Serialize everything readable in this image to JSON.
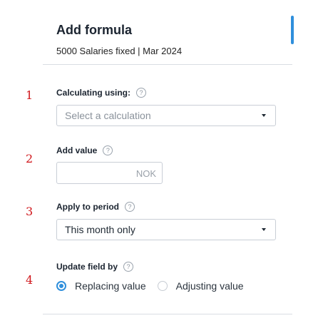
{
  "header": {
    "title": "Add formula",
    "subtitle": "5000 Salaries fixed | Mar 2024"
  },
  "steps": [
    "1",
    "2",
    "3",
    "4"
  ],
  "calculation": {
    "label": "Calculating using:",
    "placeholder": "Select a calculation"
  },
  "value": {
    "label": "Add value",
    "currency": "NOK",
    "current_value": ""
  },
  "period": {
    "label": "Apply to period",
    "selected": "This month only"
  },
  "update": {
    "label": "Update field by",
    "options": [
      {
        "label": "Replacing value",
        "selected": true
      },
      {
        "label": "Adjusting value",
        "selected": false
      }
    ]
  },
  "help_glyph": "?",
  "colors": {
    "accent": "#2f8fdc",
    "step_number": "#d0161b",
    "divider": "#d9dde3"
  }
}
